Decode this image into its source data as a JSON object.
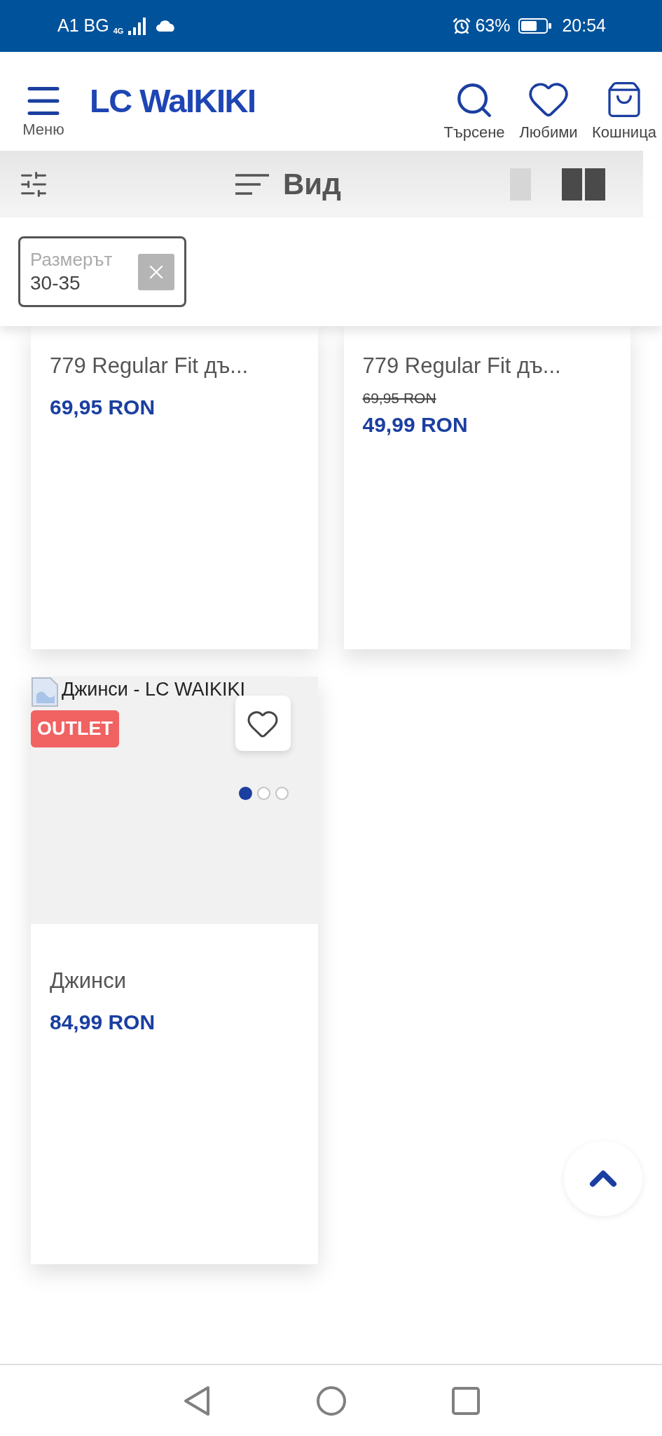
{
  "status_bar": {
    "carrier": "A1 BG",
    "network": "4G",
    "battery": "63%",
    "time": "20:54"
  },
  "header": {
    "menu_label": "Меню",
    "logo": "LC WaIKIKI",
    "actions": [
      {
        "kind": "search",
        "label": "Търсене"
      },
      {
        "kind": "favorites",
        "label": "Любими"
      },
      {
        "kind": "cart",
        "label": "Кошница"
      }
    ]
  },
  "toolbar": {
    "sort_label": "Вид",
    "view_modes": [
      {
        "kind": "single",
        "selected": false
      },
      {
        "kind": "double",
        "selected": true
      }
    ]
  },
  "filters": [
    {
      "name": "Размерът",
      "value": "30-35"
    }
  ],
  "products": [
    {
      "title": "779 Regular Fit дъ...",
      "price": "69,95 RON"
    },
    {
      "title": "779 Regular Fit дъ...",
      "old_price": "69,95 RON",
      "price": "49,99 RON"
    },
    {
      "image_alt": "Джинси - LC WAIKIKI",
      "badge": "OUTLET",
      "favorite": false,
      "dots": [
        {
          "selected": true
        },
        {
          "selected": false
        },
        {
          "selected": false
        }
      ],
      "title": "Джинси",
      "price": "84,99 RON"
    }
  ]
}
